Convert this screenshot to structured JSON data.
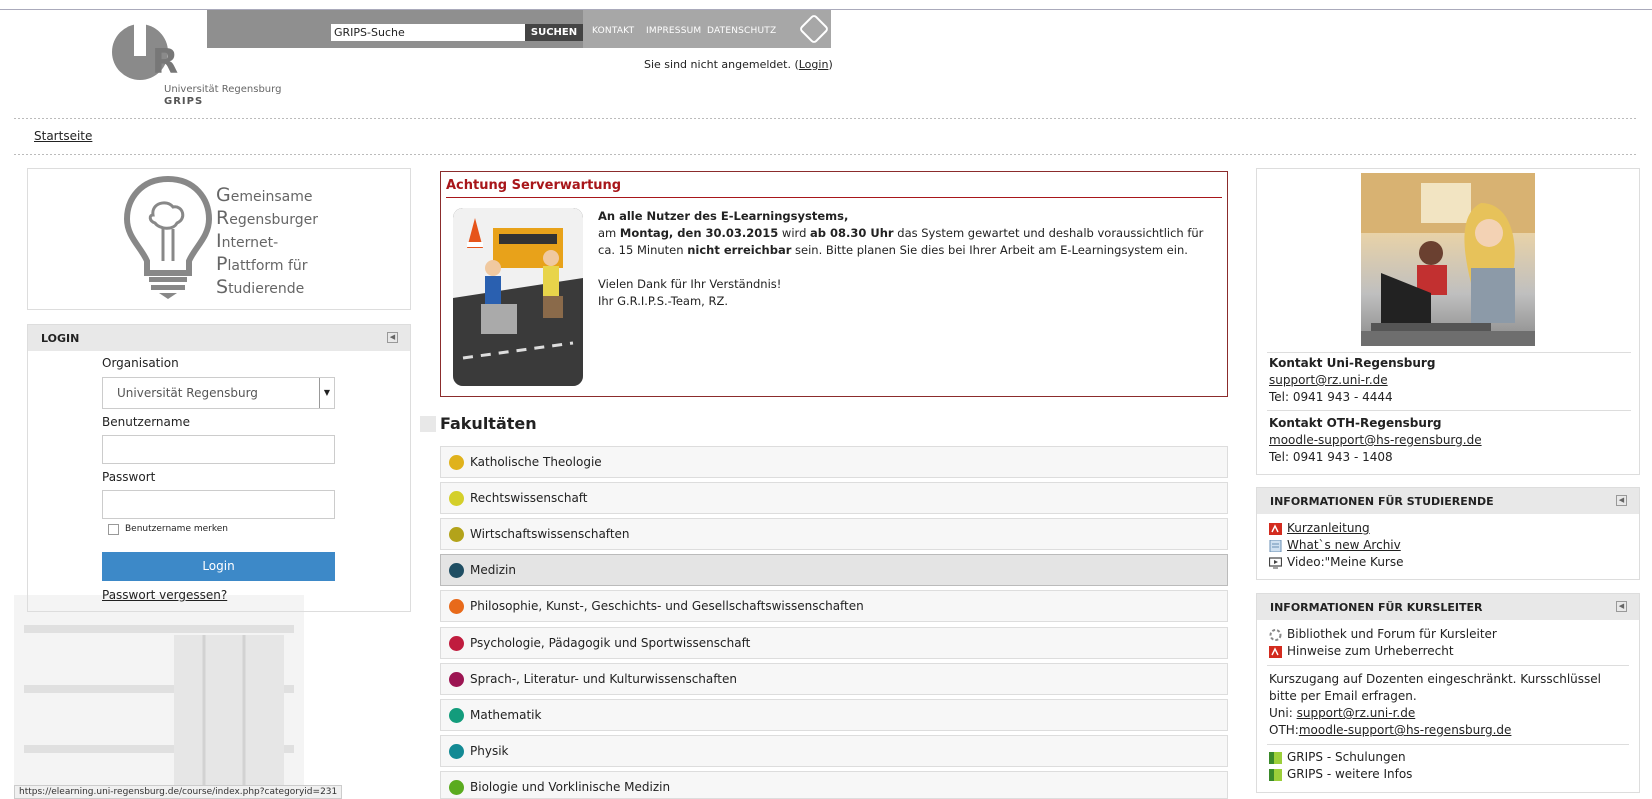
{
  "header": {
    "logo_uni": "Universität Regensburg",
    "logo_grips": "GRIPS",
    "search_placeholder": "GRIPS-Suche",
    "search_button": "SUCHEN",
    "nav": [
      "KONTAKT",
      "IMPRESSUM",
      "DATENSCHUTZ"
    ],
    "login_status_prefix": "Sie sind nicht angemeldet. (",
    "login_link": "Login",
    "login_status_suffix": ")"
  },
  "breadcrumb": "Startseite",
  "grips": {
    "lines": [
      {
        "initial": "G",
        "rest": "emeinsame"
      },
      {
        "initial": "R",
        "rest": "egensburger"
      },
      {
        "initial": "I",
        "rest": "nternet-"
      },
      {
        "initial": "P",
        "rest": "lattform für"
      },
      {
        "initial": "S",
        "rest": "tudierende"
      }
    ]
  },
  "login": {
    "title": "LOGIN",
    "org_label": "Organisation",
    "org_value": "Universität Regensburg",
    "user_label": "Benutzername",
    "pass_label": "Passwort",
    "remember_label": "Benutzername merken",
    "button": "Login",
    "forgot": "Passwort vergessen?"
  },
  "status_url": "https://elearning.uni-regensburg.de/course/index.php?categoryid=231",
  "notice": {
    "title": "Achtung Serverwartung",
    "heading": "An alle Nutzer des E-Learningsystems,",
    "p1_a": "am ",
    "p1_b": "Montag, den 30.03.2015",
    "p1_c": " wird ",
    "p1_d": "ab 08.30 Uhr",
    "p1_e": " das System gewartet und deshalb voraussichtlich für ca. 15 Minuten ",
    "p1_f": "nicht erreichbar",
    "p1_g": " sein. Bitte planen Sie dies bei Ihrer Arbeit am E-Learningsystem ein.",
    "thanks": "Vielen Dank für Ihr Verständnis!",
    "sign": "Ihr G.R.I.P.S.-Team, RZ."
  },
  "faculties": {
    "title": "Fakultäten",
    "items": [
      {
        "label": "Katholische Theologie",
        "color": "#e0b21c"
      },
      {
        "label": "Rechtswissenschaft",
        "color": "#d4cf2a"
      },
      {
        "label": "Wirtschaftswissenschaften",
        "color": "#b3a31a"
      },
      {
        "label": "Medizin",
        "color": "#1f4e63"
      },
      {
        "label": "Philosophie, Kunst-, Geschichts- und Gesellschaftswissenschaften",
        "color": "#e86a1a"
      },
      {
        "label": "Psychologie, Pädagogik und Sportwissenschaft",
        "color": "#c01c3e"
      },
      {
        "label": "Sprach-, Literatur- und Kulturwissenschaften",
        "color": "#9c1552"
      },
      {
        "label": "Mathematik",
        "color": "#139c7c"
      },
      {
        "label": "Physik",
        "color": "#138a94"
      },
      {
        "label": "Biologie und Vorklinische Medizin",
        "color": "#5aab1f"
      }
    ]
  },
  "contact": {
    "uni_title": "Kontakt Uni-Regensburg",
    "uni_mail": "support@rz.uni-r.de",
    "uni_tel": "Tel: 0941 943 - 4444",
    "oth_title": "Kontakt OTH-Regensburg",
    "oth_mail": "moodle-support@hs-regensburg.de",
    "oth_tel": "Tel: 0941 943 - 1408"
  },
  "info_students": {
    "title": "INFORMATIONEN FÜR STUDIERENDE",
    "items": [
      "Kurzanleitung",
      "What`s new Archiv",
      "Video:\"Meine Kurse"
    ]
  },
  "info_teachers": {
    "title": "INFORMATIONEN FÜR KURSLEITER",
    "items": [
      "Bibliothek und Forum für Kursleiter",
      "Hinweise zum Urheberrecht"
    ],
    "text1": "Kurszugang auf Dozenten eingeschränkt. Kursschlüssel bitte per Email erfragen.",
    "uni_prefix": "Uni: ",
    "uni_mail": "support@rz.uni-r.de",
    "oth_prefix": "OTH:",
    "oth_mail": "moodle-support@hs-regensburg.de",
    "links": [
      "GRIPS - Schulungen",
      "GRIPS - weitere Infos"
    ]
  }
}
